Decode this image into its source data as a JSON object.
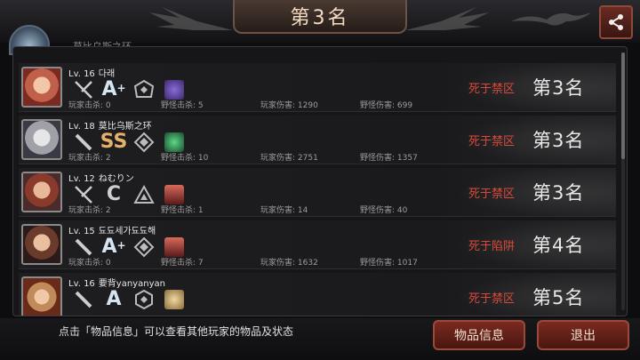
{
  "header": {
    "title": "第3名"
  },
  "behind": {
    "text": "莫比乌斯之环"
  },
  "rows": [
    {
      "level": "Lv. 16",
      "name": "다래",
      "grade": "A",
      "grade_sup": "+",
      "player_kills": "玩家击杀: 0",
      "monster_kills": "野怪击杀: 5",
      "player_dmg": "玩家伤害: 1290",
      "monster_dmg": "野怪伤害: 699",
      "death": "死于禁区",
      "rank": "第3名"
    },
    {
      "level": "Lv. 18",
      "name": "莫比乌斯之环",
      "grade": "SS",
      "grade_sup": "",
      "player_kills": "玩家击杀: 2",
      "monster_kills": "野怪击杀: 10",
      "player_dmg": "玩家伤害: 2751",
      "monster_dmg": "野怪伤害: 1357",
      "death": "死于禁区",
      "rank": "第3名"
    },
    {
      "level": "Lv. 12",
      "name": "ねむりン",
      "grade": "C",
      "grade_sup": "",
      "player_kills": "玩家击杀: 2",
      "monster_kills": "野怪击杀: 1",
      "player_dmg": "玩家伤害: 14",
      "monster_dmg": "野怪伤害: 40",
      "death": "死于禁区",
      "rank": "第3名"
    },
    {
      "level": "Lv. 15",
      "name": "됴됴세가됴됴해",
      "grade": "A",
      "grade_sup": "+",
      "player_kills": "玩家击杀: 0",
      "monster_kills": "野怪击杀: 7",
      "player_dmg": "玩家伤害: 1632",
      "monster_dmg": "野怪伤害: 1017",
      "death": "死于陷阱",
      "rank": "第4名"
    },
    {
      "level": "Lv. 16",
      "name": "要背yanyanyan",
      "grade": "A",
      "grade_sup": "",
      "player_kills": "",
      "monster_kills": "",
      "player_dmg": "",
      "monster_dmg": "",
      "death": "死于禁区",
      "rank": "第5名"
    }
  ],
  "footer": {
    "hint": "点击「物品信息」可以查看其他玩家的物品及状态",
    "info_button": "物品信息",
    "exit_button": "退出"
  },
  "colors": {
    "death": "#d94a3a",
    "button": "#7a2a20",
    "title": "#f3dcc2"
  }
}
